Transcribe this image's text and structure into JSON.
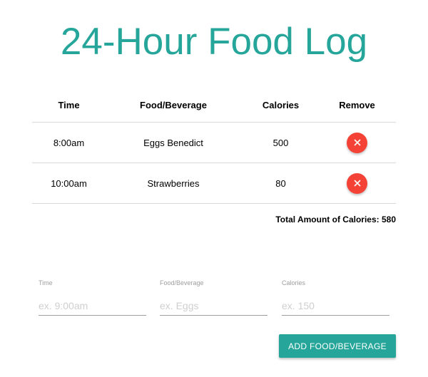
{
  "page": {
    "title": "24-Hour Food Log",
    "accent_color": "#26a69a",
    "remove_color": "#f44336"
  },
  "table": {
    "headers": {
      "time": "Time",
      "food": "Food/Beverage",
      "calories": "Calories",
      "remove": "Remove"
    },
    "rows": [
      {
        "time": "8:00am",
        "food": "Eggs Benedict",
        "calories": "500",
        "remove_icon": "close-icon"
      },
      {
        "time": "10:00am",
        "food": "Strawberries",
        "calories": "80",
        "remove_icon": "close-icon"
      }
    ]
  },
  "total": {
    "text": "Total Amount of Calories: 580"
  },
  "form": {
    "time": {
      "label": "Time",
      "placeholder": "ex. 9:00am",
      "value": ""
    },
    "food": {
      "label": "Food/Beverage",
      "placeholder": "ex. Eggs",
      "value": ""
    },
    "calories": {
      "label": "Calories",
      "placeholder": "ex. 150",
      "value": ""
    },
    "submit_label": "ADD FOOD/BEVERAGE"
  }
}
